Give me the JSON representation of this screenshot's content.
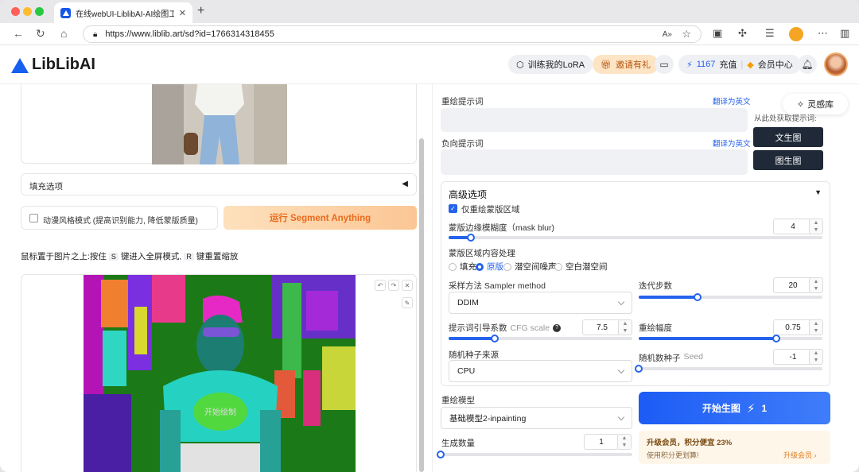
{
  "browser": {
    "tab_title": "在线webUI-LiblibAI-AI绘图工具",
    "url": "https://www.liblib.art/sd?id=1766314318455"
  },
  "header": {
    "logo_text": "LibLibAI",
    "train_lora": "训练我的LoRA",
    "invite": "邀请有礼",
    "points": "1167",
    "recharge": "充值",
    "vip_center": "会员中心"
  },
  "left": {
    "fill_options": "填充选项",
    "anime_mode": "动漫风格模式 (提高识别能力, 降低蒙版质量)",
    "run_segment": "运行 Segment Anything",
    "hint_prefix": "鼠标置于图片之上:按住",
    "hint_key_s": "S",
    "hint_mid": "键进入全屏模式,",
    "hint_key_r": "R",
    "hint_suffix": "键重置缩放",
    "seg_watermark": "开始绘制"
  },
  "right": {
    "inspiration": "灵感库",
    "redraw_prompt": "重绘提示词",
    "translate1": "翻译为英文",
    "negative_prompt": "负向提示词",
    "translate2": "翻译为英文",
    "extract_hint": "从此处获取提示词:",
    "txt2img": "文生图",
    "img2img": "图生图",
    "advanced": "高级选项",
    "only_mask": "仅重绘蒙版区域",
    "mask_blur_label": "蒙版边缘模糊度（mask blur)",
    "mask_blur_value": "4",
    "mask_blur_fraction": 0.06,
    "mask_content_label": "蒙版区域内容处理",
    "mask_content_options": [
      "填充",
      "原版",
      "潜空间噪声",
      "空白潜空间"
    ],
    "mask_content_selected": 1,
    "sampler_label": "采样方法 Sampler method",
    "sampler_value": "DDIM",
    "steps_label": "迭代步数",
    "steps_value": "20",
    "steps_fraction": 0.32,
    "cfg_label": "提示词引导系数",
    "cfg_sub": "CFG scale",
    "cfg_value": "7.5",
    "cfg_fraction": 0.25,
    "denoise_label": "重绘幅度",
    "denoise_value": "0.75",
    "denoise_fraction": 0.75,
    "seed_source_label": "随机种子来源",
    "seed_source_value": "CPU",
    "seed_label": "随机数种子",
    "seed_sub": "Seed",
    "seed_value": "-1",
    "model_label": "重绘模型",
    "model_value": "基础模型2-inpainting",
    "count_label": "生成数量",
    "count_value": "1",
    "count_fraction": 0.0,
    "generate": "开始生图",
    "generate_cost": "1",
    "upgrade_title": "升级会员，积分便宜 23%",
    "upgrade_sub": "使用积分更划算!",
    "upgrade_link": "升级会员 ›"
  },
  "colors": {
    "accent": "#2563eb",
    "generate_start": "#1d5cf5",
    "generate_end": "#3f7dfb",
    "segment_button": "#fcd3a6",
    "segment_text": "#ea6a1c",
    "upgrade_bg": "#fff6ea"
  }
}
